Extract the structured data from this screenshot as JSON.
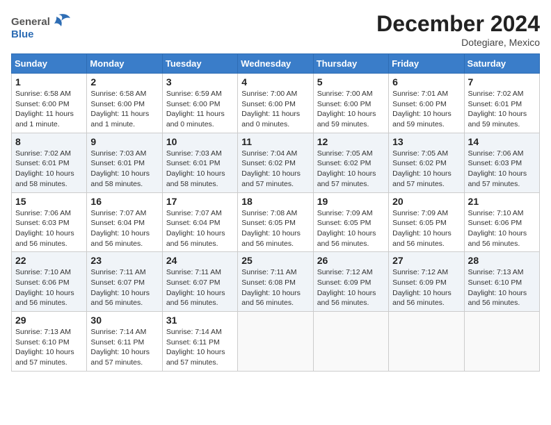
{
  "header": {
    "logo": {
      "general": "General",
      "blue": "Blue"
    },
    "title": "December 2024",
    "location": "Dotegiare, Mexico"
  },
  "calendar": {
    "days_of_week": [
      "Sunday",
      "Monday",
      "Tuesday",
      "Wednesday",
      "Thursday",
      "Friday",
      "Saturday"
    ],
    "weeks": [
      [
        {
          "day": "",
          "info": ""
        },
        {
          "day": "",
          "info": ""
        },
        {
          "day": "",
          "info": ""
        },
        {
          "day": "",
          "info": ""
        },
        {
          "day": "5",
          "info": "Sunrise: 7:00 AM\nSunset: 6:00 PM\nDaylight: 10 hours and 59 minutes."
        },
        {
          "day": "6",
          "info": "Sunrise: 7:01 AM\nSunset: 6:00 PM\nDaylight: 10 hours and 59 minutes."
        },
        {
          "day": "7",
          "info": "Sunrise: 7:02 AM\nSunset: 6:01 PM\nDaylight: 10 hours and 59 minutes."
        }
      ],
      [
        {
          "day": "1",
          "info": "Sunrise: 6:58 AM\nSunset: 6:00 PM\nDaylight: 11 hours and 1 minute."
        },
        {
          "day": "2",
          "info": "Sunrise: 6:58 AM\nSunset: 6:00 PM\nDaylight: 11 hours and 1 minute."
        },
        {
          "day": "3",
          "info": "Sunrise: 6:59 AM\nSunset: 6:00 PM\nDaylight: 11 hours and 0 minutes."
        },
        {
          "day": "4",
          "info": "Sunrise: 7:00 AM\nSunset: 6:00 PM\nDaylight: 11 hours and 0 minutes."
        },
        {
          "day": "5",
          "info": "Sunrise: 7:00 AM\nSunset: 6:00 PM\nDaylight: 10 hours and 59 minutes."
        },
        {
          "day": "6",
          "info": "Sunrise: 7:01 AM\nSunset: 6:00 PM\nDaylight: 10 hours and 59 minutes."
        },
        {
          "day": "7",
          "info": "Sunrise: 7:02 AM\nSunset: 6:01 PM\nDaylight: 10 hours and 59 minutes."
        }
      ],
      [
        {
          "day": "8",
          "info": "Sunrise: 7:02 AM\nSunset: 6:01 PM\nDaylight: 10 hours and 58 minutes."
        },
        {
          "day": "9",
          "info": "Sunrise: 7:03 AM\nSunset: 6:01 PM\nDaylight: 10 hours and 58 minutes."
        },
        {
          "day": "10",
          "info": "Sunrise: 7:03 AM\nSunset: 6:01 PM\nDaylight: 10 hours and 58 minutes."
        },
        {
          "day": "11",
          "info": "Sunrise: 7:04 AM\nSunset: 6:02 PM\nDaylight: 10 hours and 57 minutes."
        },
        {
          "day": "12",
          "info": "Sunrise: 7:05 AM\nSunset: 6:02 PM\nDaylight: 10 hours and 57 minutes."
        },
        {
          "day": "13",
          "info": "Sunrise: 7:05 AM\nSunset: 6:02 PM\nDaylight: 10 hours and 57 minutes."
        },
        {
          "day": "14",
          "info": "Sunrise: 7:06 AM\nSunset: 6:03 PM\nDaylight: 10 hours and 57 minutes."
        }
      ],
      [
        {
          "day": "15",
          "info": "Sunrise: 7:06 AM\nSunset: 6:03 PM\nDaylight: 10 hours and 56 minutes."
        },
        {
          "day": "16",
          "info": "Sunrise: 7:07 AM\nSunset: 6:04 PM\nDaylight: 10 hours and 56 minutes."
        },
        {
          "day": "17",
          "info": "Sunrise: 7:07 AM\nSunset: 6:04 PM\nDaylight: 10 hours and 56 minutes."
        },
        {
          "day": "18",
          "info": "Sunrise: 7:08 AM\nSunset: 6:05 PM\nDaylight: 10 hours and 56 minutes."
        },
        {
          "day": "19",
          "info": "Sunrise: 7:09 AM\nSunset: 6:05 PM\nDaylight: 10 hours and 56 minutes."
        },
        {
          "day": "20",
          "info": "Sunrise: 7:09 AM\nSunset: 6:05 PM\nDaylight: 10 hours and 56 minutes."
        },
        {
          "day": "21",
          "info": "Sunrise: 7:10 AM\nSunset: 6:06 PM\nDaylight: 10 hours and 56 minutes."
        }
      ],
      [
        {
          "day": "22",
          "info": "Sunrise: 7:10 AM\nSunset: 6:06 PM\nDaylight: 10 hours and 56 minutes."
        },
        {
          "day": "23",
          "info": "Sunrise: 7:11 AM\nSunset: 6:07 PM\nDaylight: 10 hours and 56 minutes."
        },
        {
          "day": "24",
          "info": "Sunrise: 7:11 AM\nSunset: 6:07 PM\nDaylight: 10 hours and 56 minutes."
        },
        {
          "day": "25",
          "info": "Sunrise: 7:11 AM\nSunset: 6:08 PM\nDaylight: 10 hours and 56 minutes."
        },
        {
          "day": "26",
          "info": "Sunrise: 7:12 AM\nSunset: 6:09 PM\nDaylight: 10 hours and 56 minutes."
        },
        {
          "day": "27",
          "info": "Sunrise: 7:12 AM\nSunset: 6:09 PM\nDaylight: 10 hours and 56 minutes."
        },
        {
          "day": "28",
          "info": "Sunrise: 7:13 AM\nSunset: 6:10 PM\nDaylight: 10 hours and 56 minutes."
        }
      ],
      [
        {
          "day": "29",
          "info": "Sunrise: 7:13 AM\nSunset: 6:10 PM\nDaylight: 10 hours and 57 minutes."
        },
        {
          "day": "30",
          "info": "Sunrise: 7:14 AM\nSunset: 6:11 PM\nDaylight: 10 hours and 57 minutes."
        },
        {
          "day": "31",
          "info": "Sunrise: 7:14 AM\nSunset: 6:11 PM\nDaylight: 10 hours and 57 minutes."
        },
        {
          "day": "",
          "info": ""
        },
        {
          "day": "",
          "info": ""
        },
        {
          "day": "",
          "info": ""
        },
        {
          "day": "",
          "info": ""
        }
      ]
    ]
  }
}
